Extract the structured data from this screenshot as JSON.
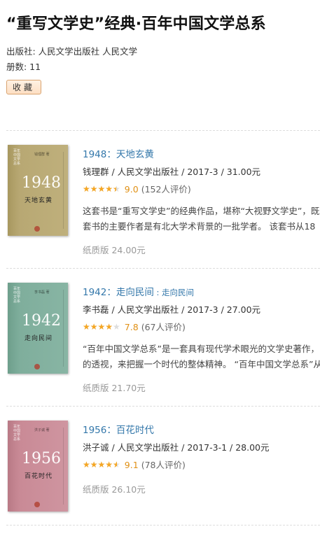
{
  "page": {
    "title": "“重写文学史”经典·百年中国文学总系",
    "publisher_line": "出版社: 人民文学出版社 人民文学",
    "count_line": "册数:  11",
    "collect_label": "收藏"
  },
  "books": [
    {
      "title": "1948：天地玄黄",
      "subtitle": "",
      "pub": "钱理群 / 人民文学出版社 / 2017-3 / 31.00元",
      "stars_fraction": 0.9,
      "score": "9.0",
      "votes": "(152人评价)",
      "desc": [
        "这套书是“重写文学史”的经典作品，堪称“大视野文学史”，既",
        "套书的主要作者是有北大学术背景的一批学者。 该套书从18"
      ],
      "paper": "纸质版 24.00元",
      "cover": {
        "year": "1948",
        "title": "天地玄黄",
        "color": "#b8a873",
        "color2": "#a8985f"
      }
    },
    {
      "title": "1942：走向民间",
      "subtitle": " : 走向民间",
      "pub": "李书磊 / 人民文学出版社 / 2017-3 / 27.00元",
      "stars_fraction": 0.78,
      "score": "7.8",
      "votes": "(67人评价)",
      "desc": [
        "“百年中国文学总系”是一套具有现代学术眼光的文学史著作，",
        "的透视，来把握一个时代的整体精神。 “百年中国文学总系”从"
      ],
      "paper": "纸质版 21.70元",
      "cover": {
        "year": "1942",
        "title": "走向民间",
        "color": "#7fae9c",
        "color2": "#6e9f8c"
      }
    },
    {
      "title": "1956：百花时代",
      "subtitle": "",
      "pub": "洪子诚 / 人民文学出版社 / 2017-3-1 / 28.00元",
      "stars_fraction": 0.91,
      "score": "9.1",
      "votes": "(78人评价)",
      "desc": [
        "",
        ""
      ],
      "paper": "纸质版 26.10元",
      "cover": {
        "year": "1956",
        "title": "百花时代",
        "color": "#c98a96",
        "color2": "#b97a86"
      }
    }
  ]
}
